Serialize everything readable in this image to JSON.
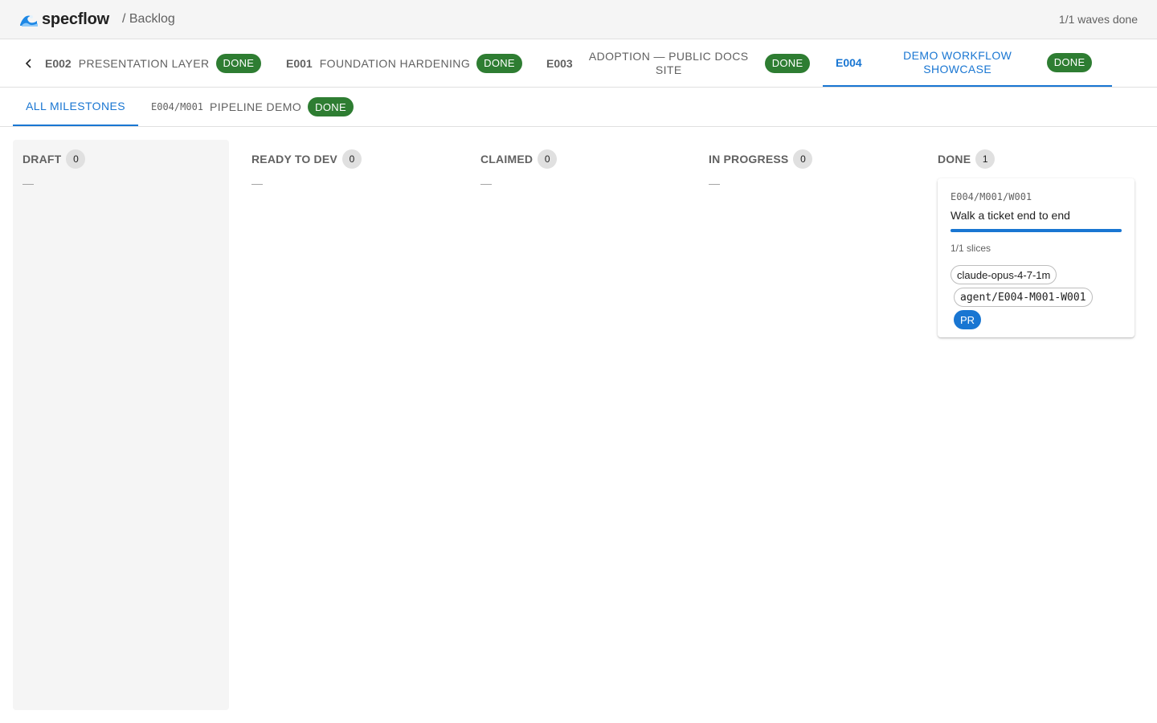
{
  "header": {
    "logo_text": "specflow",
    "breadcrumb": "/ Backlog",
    "waves_status": "1/1 waves done"
  },
  "epics": [
    {
      "id": "E002",
      "name": "PRESENTATION LAYER",
      "status": "DONE",
      "active": false
    },
    {
      "id": "E001",
      "name": "FOUNDATION HARDENING",
      "status": "DONE",
      "active": false
    },
    {
      "id": "E003",
      "name_line1": "ADOPTION — PUBLIC DOCS",
      "name_line2": "SITE",
      "status": "DONE",
      "active": false
    },
    {
      "id": "E004",
      "name_line1": "DEMO WORKFLOW",
      "name_line2": "SHOWCASE",
      "status": "DONE",
      "active": true
    }
  ],
  "milestones": {
    "all_label": "ALL MILESTONES",
    "items": [
      {
        "code": "E004/M001",
        "name": "PIPELINE DEMO",
        "status": "DONE"
      }
    ]
  },
  "columns": [
    {
      "title": "DRAFT",
      "count": "0",
      "empty": "—"
    },
    {
      "title": "READY TO DEV",
      "count": "0",
      "empty": "—"
    },
    {
      "title": "CLAIMED",
      "count": "0",
      "empty": "—"
    },
    {
      "title": "IN PROGRESS",
      "count": "0",
      "empty": "—"
    },
    {
      "title": "DONE",
      "count": "1",
      "cards": [
        {
          "code": "E004/M001/W001",
          "title": "Walk a ticket end to end",
          "progress": 1.0,
          "slices": "1/1 slices",
          "model": "claude-opus-4-7-1m",
          "branch": "agent/E004-M001-W001",
          "pr_label": "PR"
        }
      ]
    }
  ],
  "colors": {
    "accent": "#1976d2",
    "done_chip": "#2e7d32",
    "header_bg": "#f5f5f5"
  }
}
